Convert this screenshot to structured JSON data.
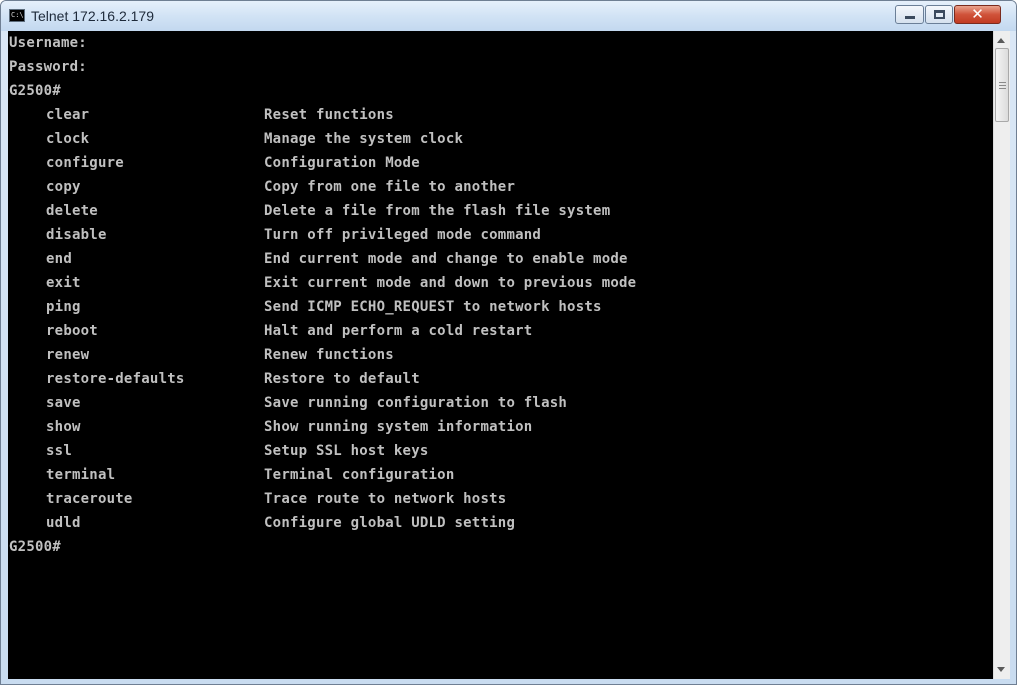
{
  "window": {
    "title": "Telnet 172.16.2.179",
    "icon": "console-icon",
    "icon_text": "C:\\",
    "controls": {
      "minimize": "minimize-icon",
      "maximize": "maximize-icon",
      "close": "close-icon",
      "close_glyph": "✕"
    }
  },
  "console": {
    "header_lines": [
      "Username:",
      "Password:",
      "G2500#"
    ],
    "commands": [
      {
        "name": "clear",
        "description": "Reset functions"
      },
      {
        "name": "clock",
        "description": "Manage the system clock"
      },
      {
        "name": "configure",
        "description": "Configuration Mode"
      },
      {
        "name": "copy",
        "description": "Copy from one file to another"
      },
      {
        "name": "delete",
        "description": "Delete a file from the flash file system"
      },
      {
        "name": "disable",
        "description": "Turn off privileged mode command"
      },
      {
        "name": "end",
        "description": "End current mode and change to enable mode"
      },
      {
        "name": "exit",
        "description": "Exit current mode and down to previous mode"
      },
      {
        "name": "ping",
        "description": "Send ICMP ECHO_REQUEST to network hosts"
      },
      {
        "name": "reboot",
        "description": "Halt and perform a cold restart"
      },
      {
        "name": "renew",
        "description": "Renew functions"
      },
      {
        "name": "restore-defaults",
        "description": "Restore to default"
      },
      {
        "name": "save",
        "description": "Save running configuration to flash"
      },
      {
        "name": "show",
        "description": "Show running system information"
      },
      {
        "name": "ssl",
        "description": "Setup SSL host keys"
      },
      {
        "name": "terminal",
        "description": "Terminal configuration"
      },
      {
        "name": "traceroute",
        "description": "Trace route to network hosts"
      },
      {
        "name": "udld",
        "description": "Configure global UDLD setting"
      }
    ],
    "prompt": "G2500#"
  },
  "colors": {
    "console_background": "#000000",
    "console_text": "#c0c0c0",
    "close_button": "#c9432a"
  }
}
